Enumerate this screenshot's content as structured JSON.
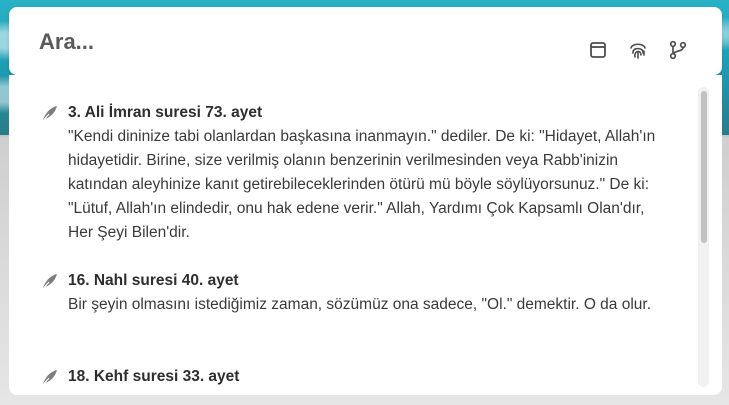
{
  "search": {
    "placeholder": "Ara..."
  },
  "header_icons": [
    "window-icon",
    "fingerprint-icon",
    "branch-icon"
  ],
  "results": [
    {
      "title": "3. Ali İmran suresi 73. ayet",
      "text": "\"Kendi dininize tabi olanlardan başkasına inanmayın.\" dediler. De ki: \"Hidayet, Allah'ın hidayetidir. Birine, size verilmiş olanın benzerinin verilmesinden veya Rabb'inizin katından aleyhinize kanıt getirebileceklerinden ötürü mü böyle söylüyorsunuz.\" De ki: \"Lütuf, Allah'ın elindedir, onu hak edene verir.\" Allah, Yardımı Çok Kapsamlı Olan'dır, Her Şeyi Bilen'dir."
    },
    {
      "title": "16. Nahl suresi 40. ayet",
      "text": "Bir şeyin olmasını istediğimiz zaman, sözümüz ona sadece, \"Ol.\" demektir. O da olur."
    },
    {
      "title": "18. Kehf suresi 33. ayet",
      "text": ""
    }
  ],
  "colors": {
    "accent": "#3a3a3a",
    "icon": "#5f5f5f",
    "leaf": "#7d7d7d"
  }
}
